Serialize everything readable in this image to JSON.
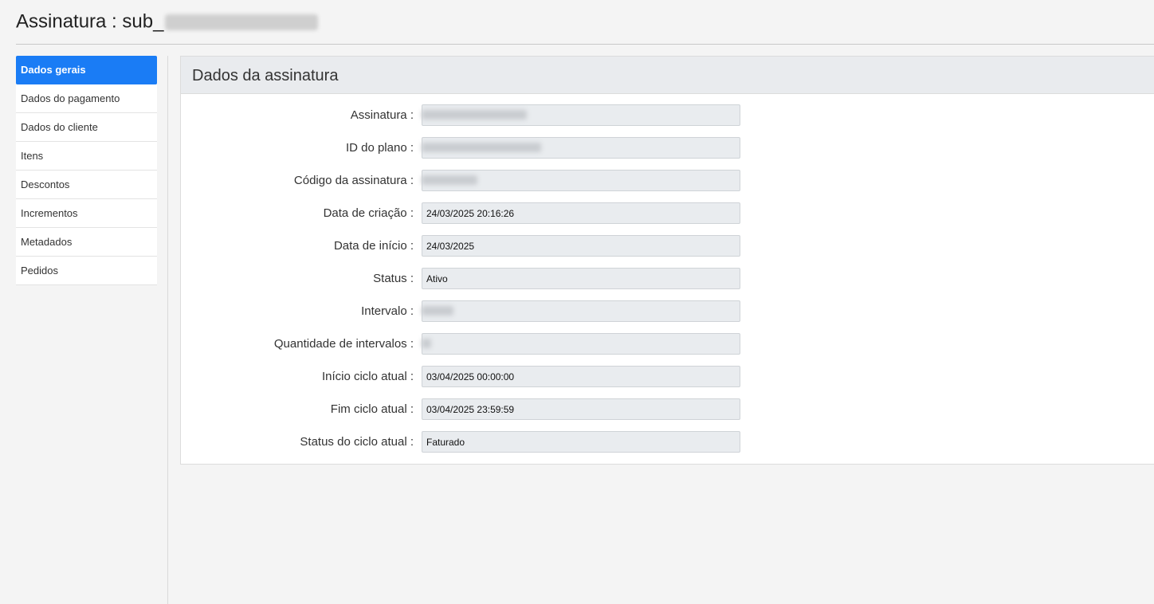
{
  "header": {
    "title_prefix": "Assinatura : sub_"
  },
  "sidebar": {
    "items": [
      {
        "label": "Dados gerais",
        "active": true
      },
      {
        "label": "Dados do pagamento"
      },
      {
        "label": "Dados do cliente"
      },
      {
        "label": "Itens"
      },
      {
        "label": "Descontos"
      },
      {
        "label": "Incrementos"
      },
      {
        "label": "Metadados"
      },
      {
        "label": "Pedidos"
      }
    ]
  },
  "card": {
    "title": "Dados da assinatura",
    "fields": [
      {
        "label": "Assinatura :",
        "value": ""
      },
      {
        "label": "ID do plano :",
        "value": ""
      },
      {
        "label": "Código da assinatura :",
        "value": ""
      },
      {
        "label": "Data de criação :",
        "value": "24/03/2025 20:16:26"
      },
      {
        "label": "Data de início :",
        "value": "24/03/2025"
      },
      {
        "label": "Status :",
        "value": "Ativo"
      },
      {
        "label": "Intervalo :",
        "value": ""
      },
      {
        "label": "Quantidade de intervalos :",
        "value": ""
      },
      {
        "label": "Início ciclo atual :",
        "value": "03/04/2025 00:00:00"
      },
      {
        "label": "Fim ciclo atual :",
        "value": "03/04/2025 23:59:59"
      },
      {
        "label": "Status do ciclo atual :",
        "value": "Faturado"
      }
    ]
  },
  "colors": {
    "accent": "#1a7cf5",
    "page_background": "#f4f4f4",
    "card_header_background": "#e9ebee",
    "input_background": "#e9ecef"
  }
}
